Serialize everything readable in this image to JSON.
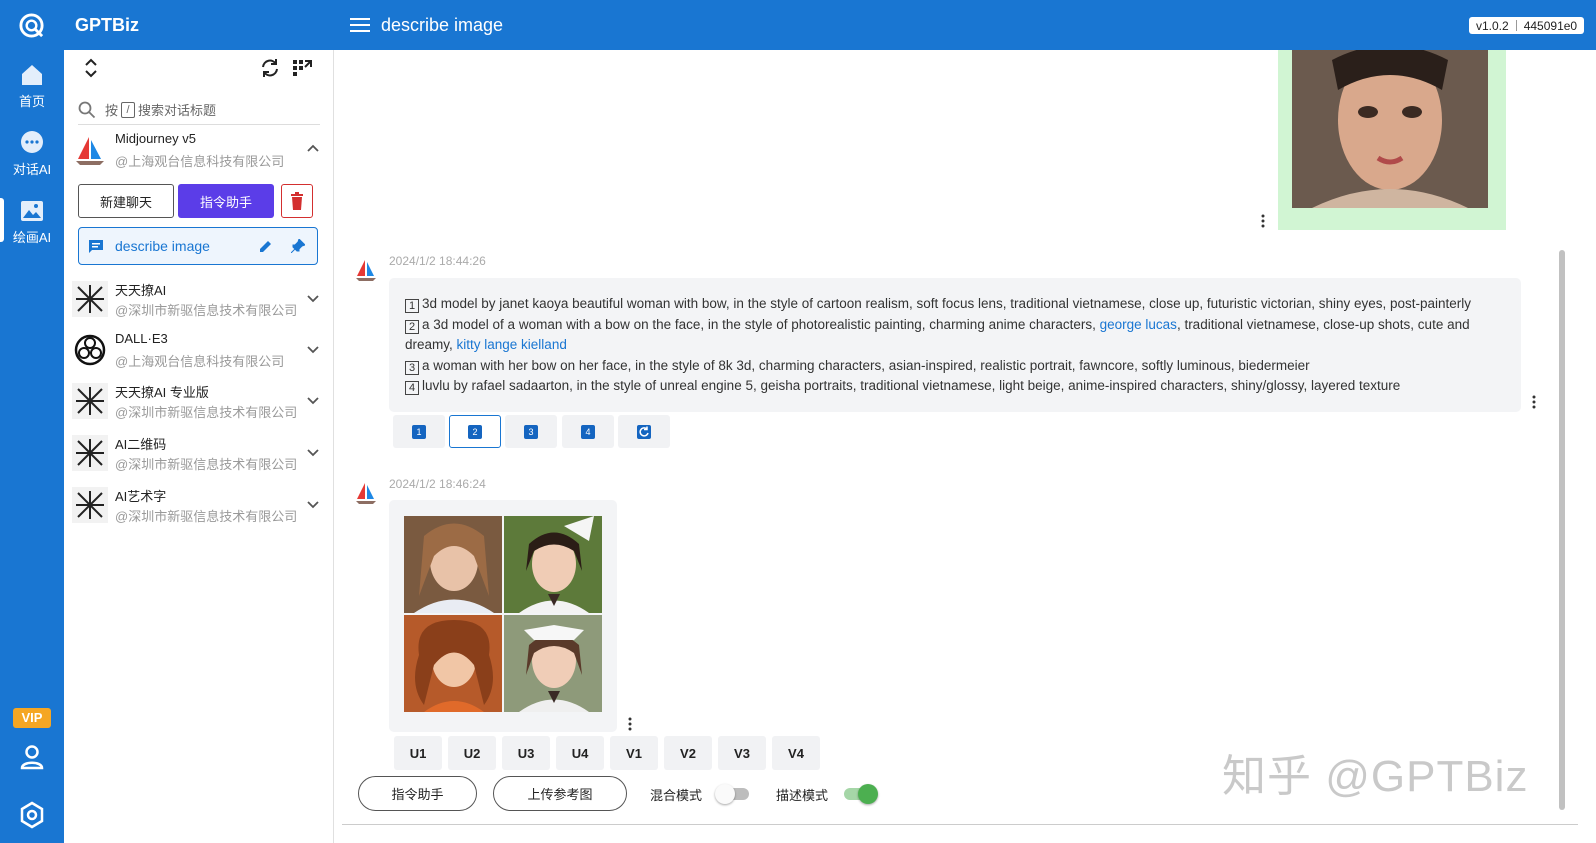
{
  "app": {
    "name": "GPTBiz",
    "page_title": "describe image",
    "version": "v1.0.2",
    "build": "445091e0"
  },
  "rail": {
    "items": [
      {
        "label": "首页"
      },
      {
        "label": "对话AI"
      },
      {
        "label": "绘画AI"
      }
    ],
    "vip": "VIP"
  },
  "sidebar": {
    "search_prefix": "按",
    "search_key": "/",
    "search_suffix": "搜索对话标题",
    "groups": [
      {
        "name": "Midjourney v5",
        "sub": "@上海观台信息科技有限公司"
      },
      {
        "name": "天天撩AI",
        "sub": "@深圳市新驱信息技术有限公司"
      },
      {
        "name": "DALL·E3",
        "sub": "@上海观台信息科技有限公司"
      },
      {
        "name": "天天撩AI 专业版",
        "sub": "@深圳市新驱信息技术有限公司"
      },
      {
        "name": "AI二维码",
        "sub": "@深圳市新驱信息技术有限公司"
      },
      {
        "name": "AI艺术字",
        "sub": "@深圳市新驱信息技术有限公司"
      }
    ],
    "new_chat": "新建聊天",
    "cmd_helper": "指令助手",
    "active_chat": "describe image"
  },
  "chat": {
    "msg1_time": "2024/1/2 18:44:26",
    "lines": [
      {
        "n": "1",
        "a": "3d model by janet kaoya  beautiful woman with bow, in the style of cartoon realism, soft focus lens, traditional vietnamese, close up, futuristic victorian, shiny eyes, post-painterly"
      },
      {
        "n": "2",
        "a": "a 3d model of a woman with a bow on the face, in the style of photorealistic painting, charming anime characters, ",
        "link1": "george lucas",
        "b": ", traditional vietnamese, close-up shots, cute and dreamy, ",
        "link2": "kitty lange kielland"
      },
      {
        "n": "3",
        "a": "a woman with her bow on her face, in the style of 8k 3d, charming characters, asian-inspired, realistic portrait, fawncore, softly luminous, biedermeier"
      },
      {
        "n": "4",
        "a": "luvlu by rafael sadaarton, in the style of unreal engine 5, geisha portraits, traditional vietnamese, light beige, anime-inspired characters, shiny/glossy, layered texture"
      }
    ],
    "num_buttons": [
      "1",
      "2",
      "3",
      "4"
    ],
    "msg2_time": "2024/1/2 18:46:24",
    "u_buttons": [
      "U1",
      "U2",
      "U3",
      "U4",
      "V1",
      "V2",
      "V3",
      "V4"
    ]
  },
  "bottom": {
    "cmd_helper": "指令助手",
    "upload_ref": "上传参考图",
    "mix_mode": "混合模式",
    "mix_mode_on": false,
    "describe_mode": "描述模式",
    "describe_mode_on": true
  },
  "watermark": "知乎 @GPTBiz",
  "colors": {
    "primary": "#1976d2",
    "accent": "#5b3de8",
    "toggle_on": "#4caf50",
    "danger": "#d32f2f"
  }
}
